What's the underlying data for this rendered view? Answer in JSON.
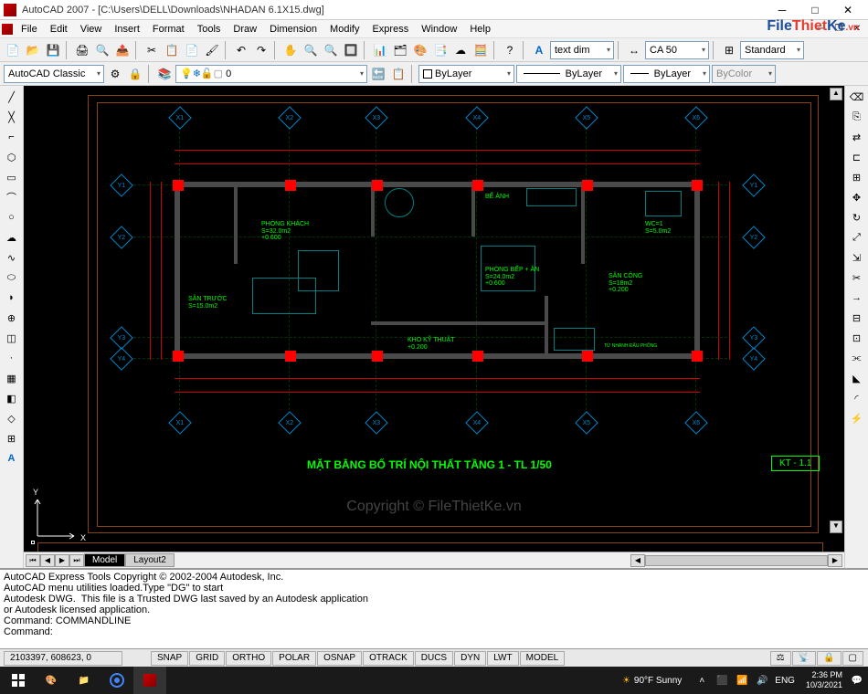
{
  "titlebar": {
    "app": "AutoCAD 2007",
    "filepath": "[C:\\Users\\DELL\\Downloads\\NHADAN 6.1X15.dwg]"
  },
  "menu": [
    "File",
    "Edit",
    "View",
    "Insert",
    "Format",
    "Tools",
    "Draw",
    "Dimension",
    "Modify",
    "Express",
    "Window",
    "Help"
  ],
  "logo": {
    "part1": "File",
    "part2": "Thiet",
    "part3": "Ke",
    "part4": ".vn"
  },
  "dropdowns": {
    "workspace": "AutoCAD Classic",
    "layer": "0",
    "textStyle": "text dim",
    "dimStyle": "CA 50",
    "tableStyle": "Standard",
    "colorControl": "ByLayer",
    "linetype": "ByLayer",
    "lineweight": "ByLayer",
    "plotstyle": "ByColor"
  },
  "tabs": {
    "active": "Model",
    "other": [
      "Layout2"
    ]
  },
  "command": {
    "lines": [
      "AutoCAD Express Tools Copyright © 2002-2004 Autodesk, Inc.",
      "AutoCAD menu utilities loaded.Type \"DG\" to start",
      "Autodesk DWG.  This file is a Trusted DWG last saved by an Autodesk application",
      "or Autodesk licensed application.",
      "Command: COMMANDLINE"
    ],
    "prompt": "Command:"
  },
  "status": {
    "coords": "2103397, 608623, 0",
    "modes": [
      "SNAP",
      "GRID",
      "ORTHO",
      "POLAR",
      "OSNAP",
      "OTRACK",
      "DUCS",
      "DYN",
      "LWT",
      "MODEL"
    ],
    "copyright": "Copyright © FileThietKe.vn"
  },
  "taskbar": {
    "weather": "90°F Sunny",
    "lang": "ENG",
    "time": "2:36 PM",
    "date": "10/3/2021"
  },
  "drawing": {
    "title": "MẶT BẰNG BỐ TRÍ NỘI THẤT TẦNG 1 - TL 1/50",
    "sheet": "KT - 1.1",
    "rooms": {
      "phongkhach": "PHÒNG KHÁCH\nS=32.0m2\n+0.600",
      "santruoc": "SÂN TRƯỚC\nS=15.0m2",
      "khokyth": "KHO KỸ THUẬT\n+0.200",
      "phongbep": "PHÒNG BẾP + ĂN\nS=24.0m2\n+0.600",
      "beamh": "BỂ ẢNH",
      "sancong": "SÂN CÔNG\nS=18m2\n+0.200",
      "wc": "WC=1\nS=5.0m2",
      "tenhanh": "TỪ NHÀNH ĐẤU PHỐNG"
    },
    "gridlabels": {
      "h": [
        "Y1",
        "Y2",
        "Y2",
        "Y3",
        "Y4"
      ],
      "v": [
        "X1",
        "X2",
        "X3",
        "X4",
        "X5"
      ]
    }
  }
}
